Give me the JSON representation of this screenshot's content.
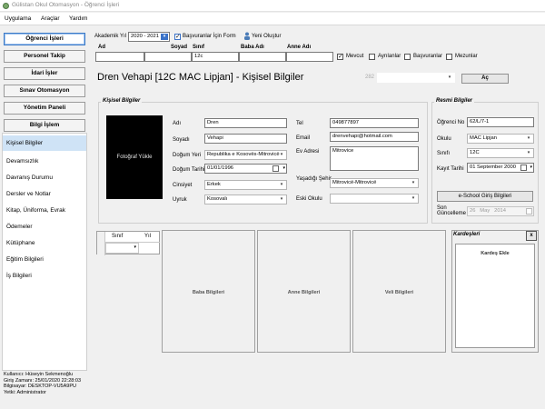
{
  "window": {
    "title": "Gülistan Okul Otomasyon - Öğrenci İşleri"
  },
  "menu": [
    "Uygulama",
    "Araçlar",
    "Yardım"
  ],
  "sidebar": {
    "modules": [
      "Öğrenci İşleri",
      "Personel Takip",
      "İdari İşler",
      "Sınav Otomasyon",
      "Yönetim Paneli",
      "Bilgi İşlem"
    ],
    "active_module": "Öğrenci İşleri",
    "items": [
      "Kişisel Bilgiler",
      "Devamsızlık",
      "Davranış Durumu",
      "Dersler ve Notlar",
      "Kitap, Üniforma, Evrak",
      "Ödemeler",
      "Kütüphane",
      "Eğitim Bilgileri",
      "İş Bilgileri"
    ],
    "selected_item": "Kişisel Bilgiler"
  },
  "user_info": {
    "user": "Kullanıcı: Hüseyin Sekmenoğlu",
    "login": "Giriş Zamanı: 25/01/2020 22:28:03",
    "computer": "Bilgisayar: DESKTOP-VU5A9PU",
    "role": "Yetki: Administrator"
  },
  "filter": {
    "akademik_label": "Akademik",
    "yil_label": "Yıl",
    "year": "2020 - 2021",
    "basvuru_label": "Başvuranlar İçin Form",
    "basvuru_checked": true,
    "yeni_label": "Yeni Oluştur",
    "columns": [
      "Ad",
      "Soyad",
      "Sınıf",
      "Baba Adı",
      "Anne Adı"
    ],
    "values": [
      "",
      "",
      "12c",
      "",
      ""
    ],
    "mevcut_label": "Mevcut",
    "mevcut_checked": true,
    "ayrilanlar_label": "Ayrılanlar",
    "ayrilanlar_checked": false,
    "basvuranlar_label": "Başvuranlar",
    "basvuranlar_checked": false,
    "mezunlar_label": "Mezunlar",
    "mezunlar_checked": false
  },
  "header": {
    "student_title": "Dren Vehapi [12C MAC Lipjan] - Kişisel Bilgiler",
    "count": "282",
    "search_value": "",
    "open_button": "Aç"
  },
  "personal": {
    "group_title": "Kişisel Bilgiler",
    "photo_label": "Fotoğraf Yükle",
    "ad_label": "Adı",
    "ad": "Dren",
    "soyad_label": "Soyadı",
    "soyad": "Vehapi",
    "dogum_yeri_label": "Doğum Yeri",
    "dogum_yeri": "Republika e Kosovës-Mitrovicë",
    "dogum_tarihi_label": "Doğum Tarihi",
    "dogum_tarihi": "01/01/1996",
    "cinsiyet_label": "Cinsiyet",
    "cinsiyet": "Erkek",
    "uyruk_label": "Uyruk",
    "uyruk": "Kosovalı",
    "tel_label": "Tel",
    "tel": "049877897",
    "email_label": "Email",
    "email": "drenvehapi@hotmail.com",
    "ev_adresi_label": "Ev Adresi",
    "ev_adresi": "Mitrovice",
    "yasadigi_sehir_label": "Yaşadığı Şehir",
    "yasadigi_sehir": "Mitrovicë-Mitrovicë",
    "eski_okulu_label": "Eski Okulu",
    "eski_okulu": ""
  },
  "official": {
    "group_title": "Resmi Bilgiler",
    "ogrenci_no_label": "Öğrenci No",
    "ogrenci_no": "62/L/7-1",
    "okulu_label": "Okulu",
    "okulu": "MAC Lipjan",
    "sinifi_label": "Sınıfı",
    "sinifi": "12C",
    "kayit_tarihi_label": "Kayıt Tarihi",
    "kayit_tarihi": "01 September 2000",
    "eschool_button": "e-School Giriş Bilgileri",
    "son_guncelleme_label": "Son Güncelleme",
    "son_guncelleme_day": "26",
    "son_guncelleme_month": "May",
    "son_guncelleme_year": "2014"
  },
  "class_grid": {
    "columns": [
      "Sınıf",
      "Yıl"
    ]
  },
  "panels": {
    "baba": "Baba Bilgileri",
    "anne": "Anne Bilgileri",
    "veli": "Veli Bilgileri"
  },
  "siblings": {
    "title": "Kardeşleri",
    "close": "x",
    "add": "Kardeş Ekle"
  }
}
